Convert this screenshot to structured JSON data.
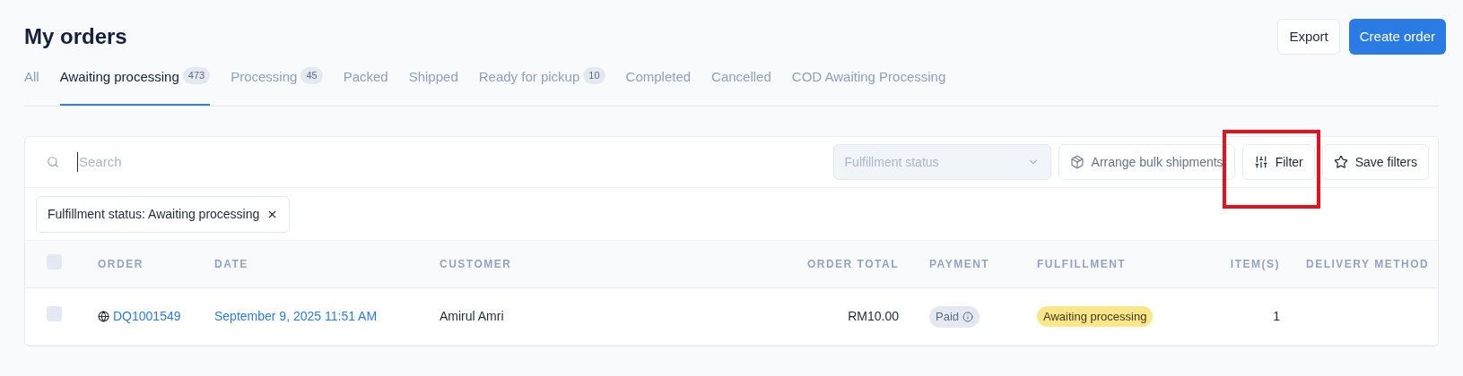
{
  "page": {
    "title": "My orders"
  },
  "actions": [
    {
      "kind": "secondary",
      "label": "Export"
    },
    {
      "kind": "primary",
      "label": "Create order"
    }
  ],
  "tabs": [
    {
      "label": "All",
      "selected": false
    },
    {
      "label": "Awaiting processing",
      "count": "473",
      "selected": true
    },
    {
      "label": "Processing",
      "count": "45",
      "selected": false
    },
    {
      "label": "Packed",
      "selected": false
    },
    {
      "label": "Shipped",
      "selected": false
    },
    {
      "label": "Ready for pickup",
      "count": "10",
      "selected": false
    },
    {
      "label": "Completed",
      "selected": false
    },
    {
      "label": "Cancelled",
      "selected": false
    },
    {
      "label": "COD Awaiting Processing",
      "selected": false
    }
  ],
  "toolbar": {
    "search": {
      "placeholder": "Search"
    },
    "status_select": {
      "placeholder": "Fulfillment status",
      "disabled": true
    },
    "buttons": [
      {
        "kind": "bulk",
        "label": "Arrange bulk shipments"
      },
      {
        "kind": "filter",
        "label": "Filter",
        "highlighted": true
      },
      {
        "kind": "save",
        "label": "Save filters"
      }
    ]
  },
  "active_filters": [
    {
      "label": "Fulfillment status: Awaiting processing"
    }
  ],
  "table": {
    "columns": [
      "ORDER",
      "DATE",
      "CUSTOMER",
      "ORDER TOTAL",
      "PAYMENT",
      "FULFILLMENT",
      "ITEM(S)",
      "DELIVERY METHOD"
    ],
    "all_checked": false,
    "rows": [
      {
        "checked": false,
        "order": "DQ1001549",
        "date": "September 9, 2025 11:51 AM",
        "customer": "Amirul Amri",
        "total": "RM10.00",
        "payment": "Paid",
        "fulfillment": "Awaiting processing",
        "items": "1"
      }
    ]
  }
}
